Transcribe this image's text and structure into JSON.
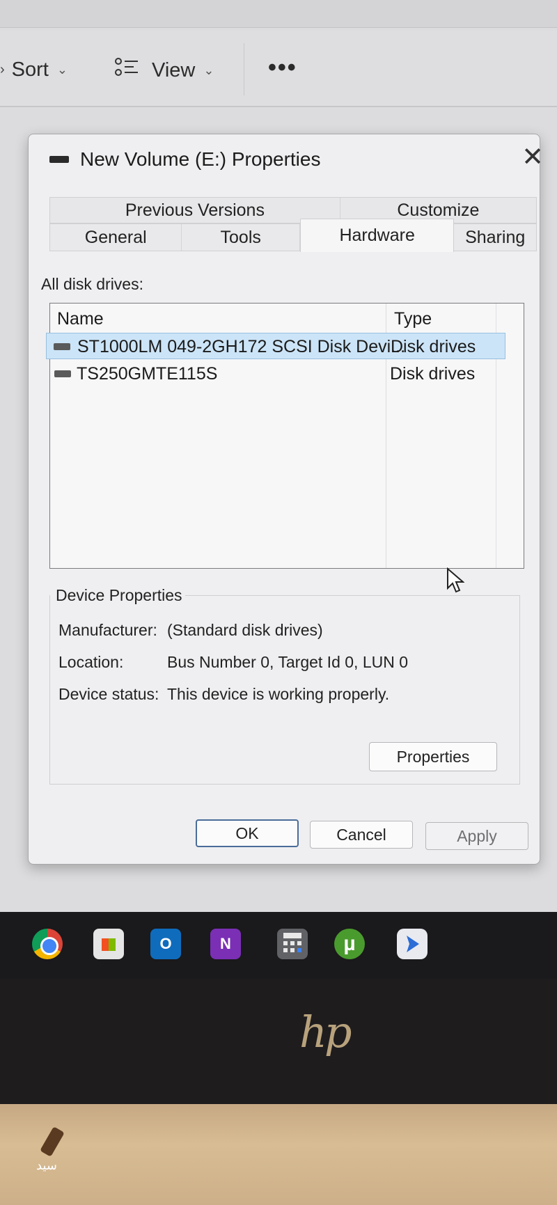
{
  "explorer": {
    "sort_label": "Sort",
    "view_label": "View",
    "more_label": "•••"
  },
  "dialog": {
    "title": "New Volume (E:) Properties",
    "close_label": "✕",
    "tabs_back": [
      "Previous Versions",
      "Customize"
    ],
    "tabs_front": [
      "General",
      "Tools",
      "Hardware",
      "Sharing"
    ],
    "active_tab": "Hardware",
    "list_caption": "All disk drives:",
    "columns": {
      "name": "Name",
      "type": "Type"
    },
    "drives": [
      {
        "name": "ST1000LM 049-2GH172 SCSI Disk Devi...",
        "type": "Disk drives",
        "selected": true
      },
      {
        "name": "TS250GMTE115S",
        "type": "Disk drives",
        "selected": false
      }
    ],
    "device_properties": {
      "heading": "Device Properties",
      "manufacturer_label": "Manufacturer:",
      "manufacturer_value": "(Standard disk drives)",
      "location_label": "Location:",
      "location_value": "Bus Number 0, Target Id 0, LUN 0",
      "status_label": "Device status:",
      "status_value": "This device is working properly.",
      "properties_button": "Properties"
    },
    "buttons": {
      "ok": "OK",
      "cancel": "Cancel",
      "apply": "Apply"
    }
  },
  "taskbar": {
    "apps": [
      "chrome-icon",
      "microsoft-store-icon",
      "outlook-icon",
      "onenote-icon",
      "calculator-icon",
      "utorrent-icon",
      "snipping-tool-icon"
    ],
    "outlook_glyph": "O",
    "onenote_glyph": "N",
    "utorrent_glyph": "µ"
  },
  "laptop": {
    "logo": "hp",
    "watermark": "سید"
  }
}
